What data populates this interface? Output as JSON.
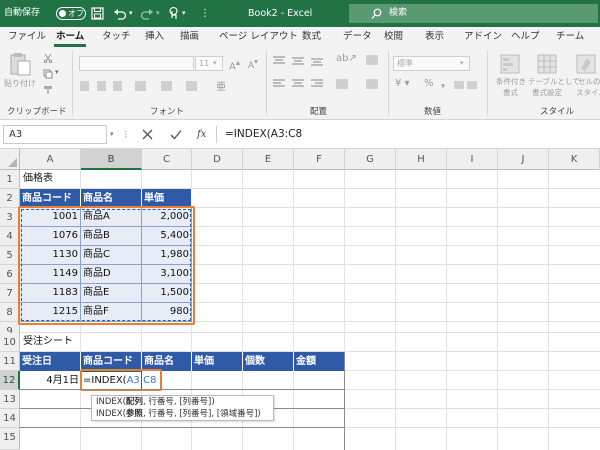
{
  "titlebar": {
    "autosave_label": "自動保存",
    "autosave_state": "オフ",
    "title": "Book2 - Excel",
    "search_placeholder": "検索"
  },
  "tabs": [
    "ファイル",
    "ホーム",
    "タッチ",
    "挿入",
    "描画",
    "ページ レイアウト",
    "数式",
    "データ",
    "校閲",
    "表示",
    "アドイン",
    "ヘルプ",
    "チーム"
  ],
  "ribbon": {
    "clipboard_label": "クリップボード",
    "paste_label": "貼り付け",
    "font_label": "フォント",
    "font_size": "11",
    "alignment_label": "配置",
    "number_label": "数値",
    "number_format": "標準",
    "style_label": "スタイル",
    "conditional_format_label1": "条件付き",
    "conditional_format_label2": "書式",
    "table_format_label1": "テーブルとして",
    "table_format_label2": "書式設定",
    "cell_style_label1": "セルの",
    "cell_style_label2": "スタイル"
  },
  "formula_bar": {
    "name_box": "A3",
    "fx": "fx",
    "formula": "=INDEX(A3:C8"
  },
  "columns": [
    "A",
    "B",
    "C",
    "D",
    "E",
    "F",
    "G",
    "H",
    "I",
    "J",
    "K"
  ],
  "rows": [
    "1",
    "2",
    "3",
    "4",
    "5",
    "6",
    "7",
    "8",
    "9",
    "10",
    "11",
    "12",
    "13",
    "14",
    "15"
  ],
  "sheet": {
    "price_table_title": "価格表",
    "price_headers": [
      "商品コード",
      "商品名",
      "単価"
    ],
    "price_rows": [
      [
        "1001",
        "商品A",
        "2,000"
      ],
      [
        "1076",
        "商品B",
        "5,400"
      ],
      [
        "1130",
        "商品C",
        "1,980"
      ],
      [
        "1149",
        "商品D",
        "3,100"
      ],
      [
        "1183",
        "商品E",
        "1,500"
      ],
      [
        "1215",
        "商品F",
        "980"
      ]
    ],
    "order_title": "受注シート",
    "order_headers": [
      "受注日",
      "商品コード",
      "商品名",
      "単価",
      "個数",
      "金額"
    ],
    "order_date": "4月1日",
    "order_formula_prefix": "=INDEX(",
    "order_formula_range": "A3:C8"
  },
  "tooltip": {
    "line1_prefix": "INDEX(",
    "line1_bold": "配列",
    "line1_suffix": ", 行番号, [列番号])",
    "line2_prefix": "INDEX(",
    "line2_bold": "参照",
    "line2_suffix": ", 行番号, [列番号], [領域番号])"
  },
  "colors": {
    "excel_green": "#217346",
    "table_header_blue": "#2e5aa7",
    "table_body": "#e7ecf6",
    "highlight_orange": "#ed7d31",
    "range_ref_blue": "#3a78c8"
  }
}
